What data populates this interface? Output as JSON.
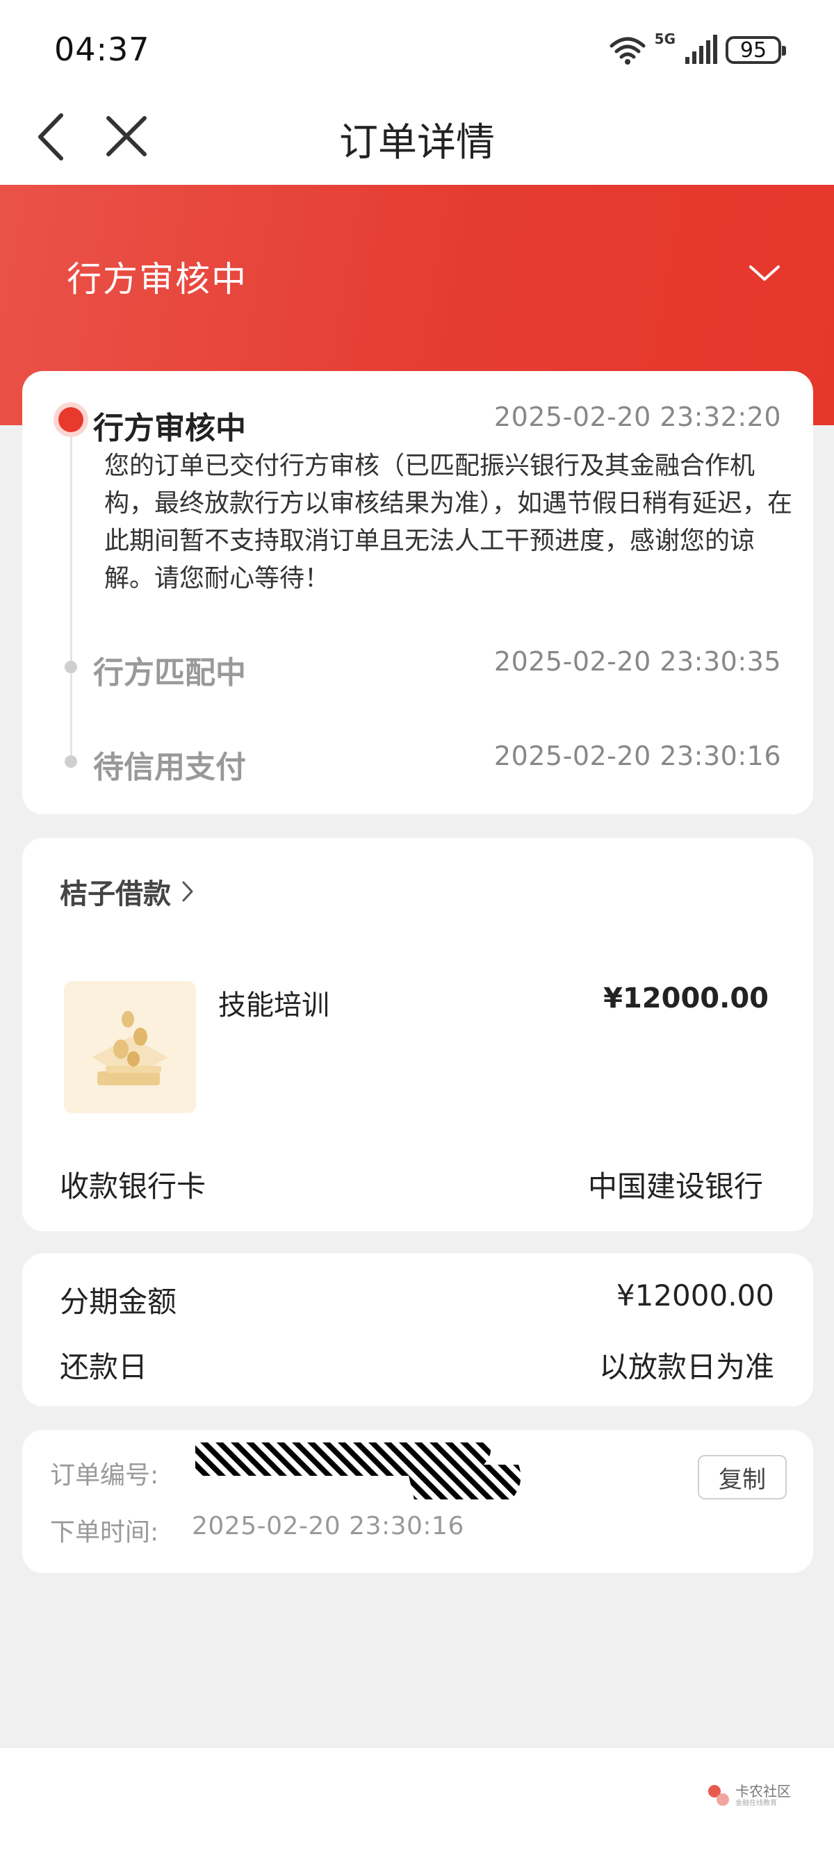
{
  "status_bar": {
    "time": "04:37",
    "network": "5G",
    "battery": "95",
    "icons": [
      "wifi-icon",
      "signal-icon",
      "battery-icon"
    ]
  },
  "nav": {
    "title": "订单详情",
    "icons": [
      "back-icon",
      "close-icon"
    ]
  },
  "header": {
    "status": "行方审核中",
    "icon": "chevron-down-icon",
    "color": "#e8392f"
  },
  "timeline": [
    {
      "title": "行方审核中",
      "time": "2025-02-20 23:32:20",
      "desc": "您的订单已交付行方审核（已匹配振兴银行及其金融合作机构，最终放款行方以审核结果为准），如遇节假日稍有延迟，在此期间暂不支持取消订单且无法人工干预进度，感谢您的谅解。请您耐心等待！",
      "active": true
    },
    {
      "title": "行方匹配中",
      "time": "2025-02-20 23:30:35",
      "active": false
    },
    {
      "title": "待信用支付",
      "time": "2025-02-20 23:30:16",
      "active": false
    }
  ],
  "product": {
    "merchant": "桔子借款",
    "name": "技能培训",
    "price": "¥12000.00",
    "bank_label": "收款银行卡",
    "bank_value": "中国建设银行"
  },
  "installment": {
    "amount_label": "分期金额",
    "amount_value": "¥12000.00",
    "repay_label": "还款日",
    "repay_value": "以放款日为准"
  },
  "order": {
    "number_label": "订单编号:",
    "time_label": "下单时间:",
    "time_value": "2025-02-20 23:30:16",
    "copy_label": "复制"
  },
  "watermark": {
    "name": "卡农社区",
    "sub": "金融在线教育"
  }
}
